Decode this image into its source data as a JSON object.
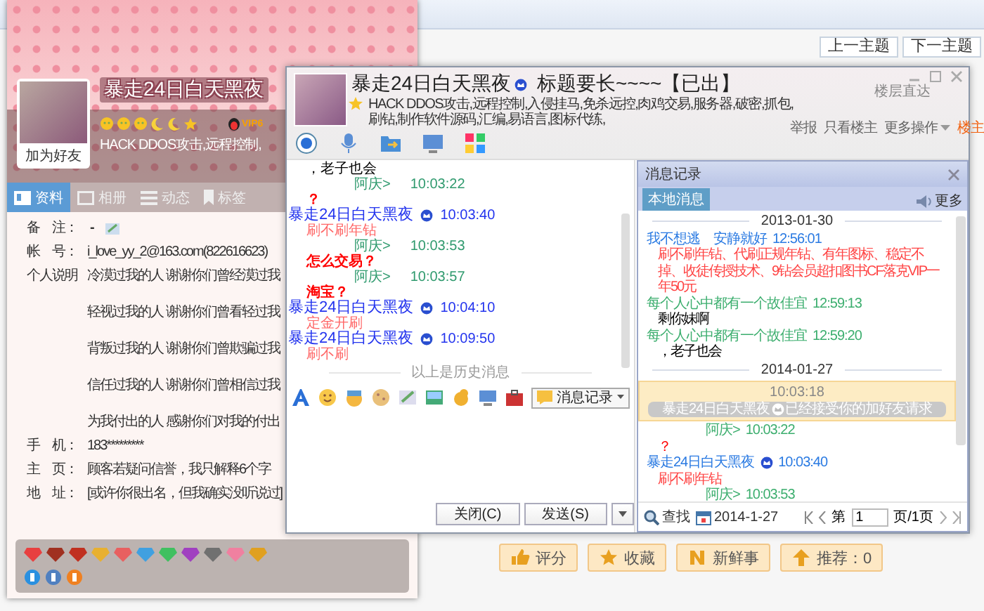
{
  "forum": {
    "nav_buttons": [
      "上一主题",
      "下一主题"
    ],
    "post_title": "标题要长~~~~【已出】",
    "floor_jump": "楼层直达",
    "post_actions": [
      {
        "label": "举报",
        "kind": "link"
      },
      {
        "label": "只看楼主",
        "kind": "link"
      },
      {
        "label": "更多操作",
        "kind": "menu"
      },
      {
        "label": "楼主",
        "kind": "badge"
      }
    ],
    "bottom_buttons": [
      "评分",
      "收藏",
      "新鲜事",
      "推荐：0"
    ]
  },
  "profile": {
    "name": "暴走24日白天黑夜",
    "add_friend": "加为好友",
    "level_icons": [
      {
        "kind": "sun"
      },
      {
        "kind": "sun"
      },
      {
        "kind": "sun"
      },
      {
        "kind": "moon"
      },
      {
        "kind": "moon"
      },
      {
        "kind": "star"
      }
    ],
    "vip": "VIP6",
    "signature": "HACK DDOS攻击,远程控制,",
    "tabs": [
      {
        "label": "资料",
        "selected": true
      },
      {
        "label": "相册",
        "selected": false
      },
      {
        "label": "动态",
        "selected": false
      },
      {
        "label": "标签",
        "selected": false
      }
    ],
    "fields": [
      {
        "label": "备　注：",
        "value": "-"
      },
      {
        "label": "帐　号：",
        "value": "i_love_yy_2@163.com(822616623)"
      },
      {
        "label": "个人说明",
        "lines": [
          "冷漠过我的人 谢谢你们曾经漠过我",
          "轻视过我的人 谢谢你们曾看轻过我",
          "背叛过我的人 谢谢你们曾欺骗过我",
          "信任过我的人 谢谢你们曾相信过我",
          "为我付出的人 感谢你们对我的付出"
        ]
      },
      {
        "label": "手　机：",
        "value": "183*********"
      },
      {
        "label": "主　页：",
        "value": "顾客若疑问信誉，我只解释6个字"
      },
      {
        "label": "地　址：",
        "value": "[或许你很出名，但我确实没听说过]"
      }
    ]
  },
  "chat": {
    "title": "暴走24日白天黑夜",
    "signature": "HACK DDOS攻击,远程控制,入侵挂马,免杀远控,肉鸡交易,服务器,破密,抓包,刷钻,制作软件源码,汇编,易语言,图标代练,",
    "messages": [
      {
        "kind": "text",
        "text": "，老子也会",
        "color": "#000000",
        "bold": false
      },
      {
        "kind": "me",
        "name": "阿庆>",
        "time": "10:03:22"
      },
      {
        "kind": "text",
        "text": "？",
        "color": "#ff0000",
        "bold": true
      },
      {
        "kind": "contact",
        "name": "暴走24日白天黑夜",
        "time": "10:03:40"
      },
      {
        "kind": "text",
        "text": "刷不刷年钻",
        "color": "#ff6666",
        "bold": false
      },
      {
        "kind": "me",
        "name": "阿庆>",
        "time": "10:03:53"
      },
      {
        "kind": "text",
        "text": "怎么交易？",
        "color": "#ff0000",
        "bold": true
      },
      {
        "kind": "me",
        "name": "阿庆>",
        "time": "10:03:57"
      },
      {
        "kind": "text",
        "text": "淘宝？",
        "color": "#ff0000",
        "bold": true
      },
      {
        "kind": "contact",
        "name": "暴走24日白天黑夜",
        "time": "10:04:10"
      },
      {
        "kind": "text",
        "text": "定金开刷",
        "color": "#ff6666",
        "bold": false
      },
      {
        "kind": "contact",
        "name": "暴走24日白天黑夜",
        "time": "10:09:50"
      },
      {
        "kind": "text",
        "text": "刷不刷",
        "color": "#ff6666",
        "bold": false
      }
    ],
    "history_divider": "以上是历史消息",
    "history_button": "消息记录",
    "buttons": [
      "关闭(C)",
      "发送(S)"
    ]
  },
  "history": {
    "title": "消息记录",
    "tabs": [
      {
        "label": "本地消息",
        "selected": true
      }
    ],
    "more": "更多",
    "entries": [
      {
        "kind": "date",
        "text": "2013-01-30"
      },
      {
        "kind": "contact",
        "name": "我不想逃　安静就好",
        "time": "12:56:01",
        "color": "#2a7ae2",
        "crown": false
      },
      {
        "kind": "text",
        "text": "刷不刷年钻、代刷正规年钻、有年图标、稳定不掉、收徒传授技术、9钻会员超扣图书CF落克VIP一年50元",
        "color": "#ff4444"
      },
      {
        "kind": "contact",
        "name": "每个人心中都有一个故佳宜",
        "time": "12:59:13",
        "color": "#3cae6e",
        "crown": false
      },
      {
        "kind": "text",
        "text": "剩你妹啊",
        "color": "#000000"
      },
      {
        "kind": "contact",
        "name": "每个人心中都有一个故佳宜",
        "time": "12:59:20",
        "color": "#3cae6e",
        "crown": false
      },
      {
        "kind": "text",
        "text": "，老子也会",
        "color": "#000000"
      },
      {
        "kind": "date",
        "text": "2014-01-27"
      },
      {
        "kind": "notice",
        "time": "10:03:18",
        "name": "暴走24日白天黑夜",
        "text": "已经接受你的加好友请求"
      },
      {
        "kind": "me",
        "name": "阿庆>",
        "time": "10:03:22",
        "color": "#3cae6e",
        "crown": false
      },
      {
        "kind": "text",
        "text": "？",
        "color": "#ff0000"
      },
      {
        "kind": "contact",
        "name": "暴走24日白天黑夜",
        "time": "10:03:40",
        "color": "#2a7ae2",
        "crown": true
      },
      {
        "kind": "text",
        "text": "刷不刷年钻",
        "color": "#ff4444"
      },
      {
        "kind": "me",
        "name": "阿庆>",
        "time": "10:03:53",
        "color": "#3cae6e",
        "crown": false
      }
    ],
    "footer": {
      "search": "查找",
      "date": "2014-1-27",
      "page_prefix": "第",
      "page": "1",
      "page_suffix": "页/1页"
    }
  }
}
